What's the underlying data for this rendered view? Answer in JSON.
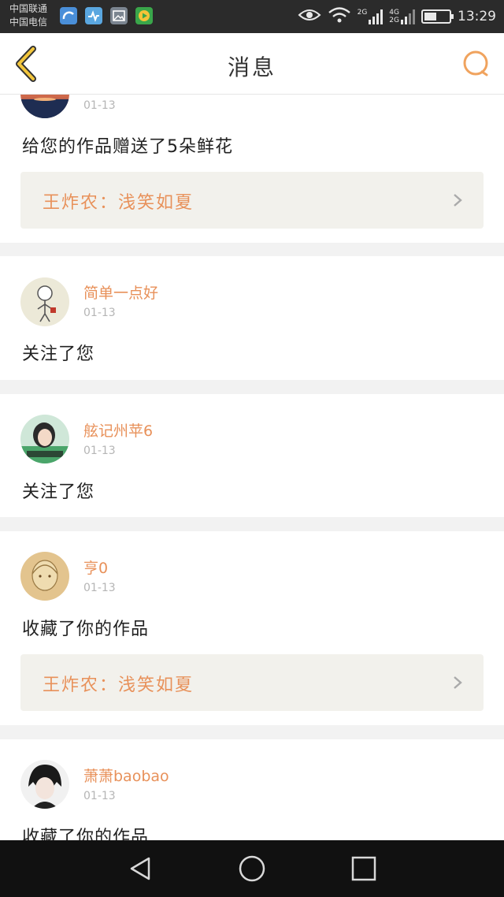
{
  "status_bar": {
    "carrier_1": "中国联通",
    "carrier_2": "中国电信",
    "net_1": "2G",
    "net_2a": "4G",
    "net_2b": "2G",
    "time": "13:29",
    "battery_level": 0.5
  },
  "header": {
    "title": "消息",
    "accent_color": "#f0a35e"
  },
  "messages": [
    {
      "username": "",
      "date": "01-13",
      "action": "给您的作品赠送了5朵鲜花",
      "work": "王炸农：浅笑如夏"
    },
    {
      "username": "简单一点好",
      "date": "01-13",
      "action": "关注了您"
    },
    {
      "username": "舷记州苹6",
      "date": "01-13",
      "action": "关注了您"
    },
    {
      "username": "亨0",
      "date": "01-13",
      "action": "收藏了你的作品",
      "work": "王炸农：浅笑如夏"
    },
    {
      "username": "萧萧baobao",
      "date": "01-13",
      "action": "收藏了你的作品"
    }
  ],
  "icons": {
    "back": "chevron-left-icon",
    "search": "search-icon",
    "nav_back": "triangle-back-icon",
    "nav_home": "circle-home-icon",
    "nav_recent": "square-recent-icon"
  }
}
